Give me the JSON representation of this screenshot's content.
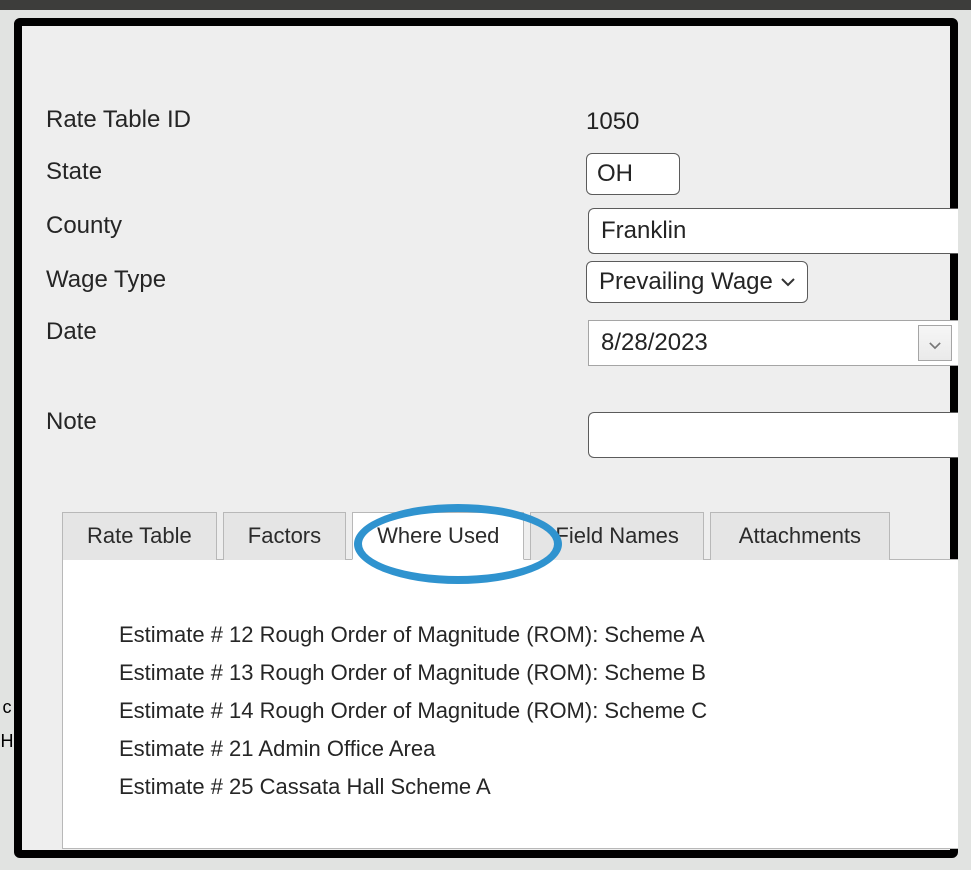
{
  "form": {
    "labels": {
      "rate_table_id": "Rate Table ID",
      "state": "State",
      "county": "County",
      "wage_type": "Wage Type",
      "date": "Date",
      "note": "Note"
    },
    "values": {
      "rate_table_id": "1050",
      "state": "OH",
      "county": "Franklin",
      "wage_type_selected": "Prevailing Wage",
      "date": "8/28/2023",
      "note": ""
    }
  },
  "tabs": {
    "rate_table": "Rate Table",
    "factors": "Factors",
    "where_used": "Where Used",
    "field_names": "Field Names",
    "attachments": "Attachments"
  },
  "where_used_items": [
    "Estimate # 12 Rough Order of Magnitude (ROM): Scheme A",
    "Estimate # 13 Rough Order of Magnitude (ROM): Scheme B",
    "Estimate # 14 Rough Order of Magnitude (ROM): Scheme C",
    "Estimate # 21 Admin Office Area",
    "Estimate # 25 Cassata Hall Scheme A"
  ]
}
